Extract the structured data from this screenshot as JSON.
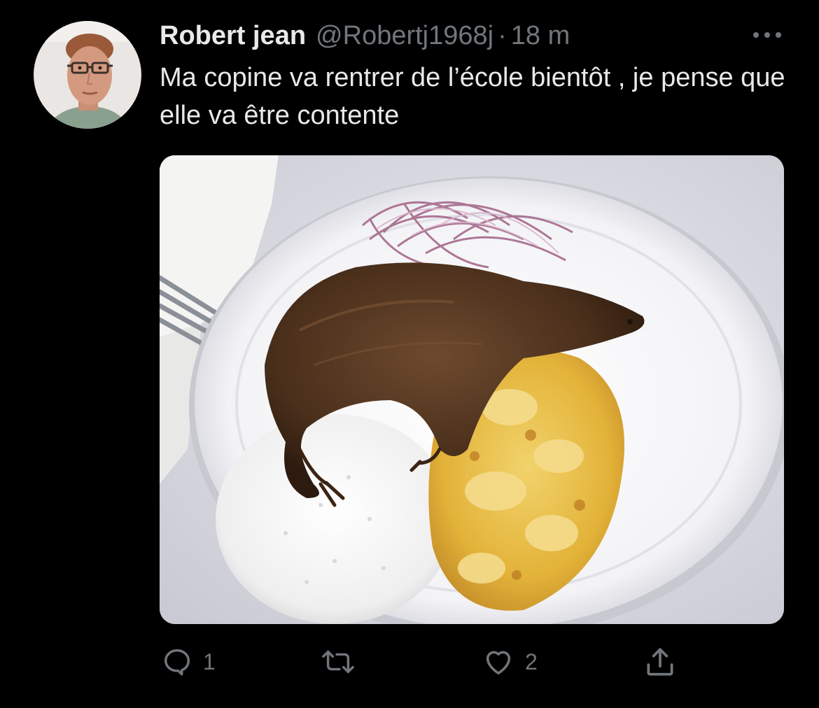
{
  "tweet": {
    "author": {
      "display_name": "Robert jean",
      "handle": "@Robertj1968j",
      "avatar_icon": "profile-photo"
    },
    "separator": "·",
    "time": "18 m",
    "text": "Ma copine va rentrer de l’école bientôt , je pense que elle va être contente",
    "media": {
      "type": "photo",
      "subject": "plate-with-fried-rodent-rice-and-potatoes"
    },
    "actions": {
      "reply": {
        "icon": "reply-icon",
        "count": "1"
      },
      "retweet": {
        "icon": "retweet-icon",
        "count": ""
      },
      "like": {
        "icon": "heart-icon",
        "count": "2"
      },
      "share": {
        "icon": "share-icon"
      }
    },
    "more_icon": "more-dots-icon"
  },
  "colors": {
    "background": "#000000",
    "primary_text": "#e7e9ea",
    "secondary_text": "#71767b"
  }
}
